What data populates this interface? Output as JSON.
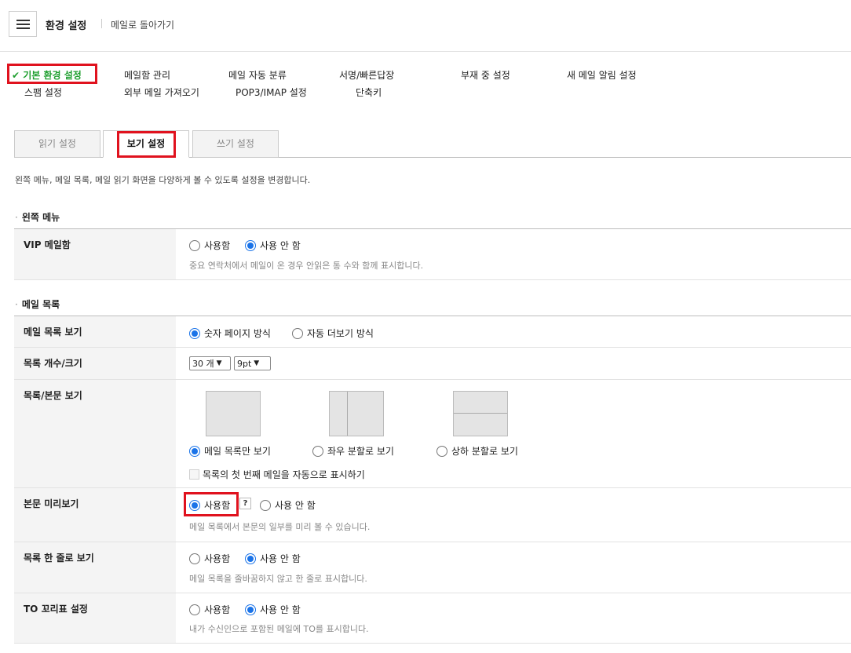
{
  "header": {
    "title": "환경 설정",
    "back_link": "메일로 돌아가기"
  },
  "nav": {
    "row1": [
      "기본 환경 설정",
      "메일함 관리",
      "메일 자동 분류",
      "서명/빠른답장",
      "부재 중 설정",
      "새 메일 알림 설정"
    ],
    "row2": [
      "스팸 설정",
      "외부 메일 가져오기",
      "POP3/IMAP 설정",
      "단축키"
    ],
    "active_check": "✔"
  },
  "tabs": [
    "읽기 설정",
    "보기 설정",
    "쓰기 설정"
  ],
  "description": "왼쪽 메뉴, 메일 목록, 메일 읽기 화면을 다양하게 볼 수 있도록 설정을 변경합니다.",
  "sections": {
    "left_menu": "왼쪽 메뉴",
    "mail_list": "메일 목록"
  },
  "settings": {
    "vip": {
      "label": "VIP 메일함",
      "options": [
        "사용함",
        "사용 안 함"
      ],
      "selected": 1,
      "help": "중요 연락처에서 메일이 온 경우 안읽은 통 수와 함께 표시합니다."
    },
    "list_view": {
      "label": "메일 목록 보기",
      "options": [
        "숫자 페이지 방식",
        "자동 더보기 방식"
      ],
      "selected": 0
    },
    "list_count": {
      "label": "목록 개수/크기",
      "count_value": "30 개",
      "size_value": "9pt"
    },
    "list_body": {
      "label": "목록/본문 보기",
      "options": [
        "메일 목록만 보기",
        "좌우 분할로 보기",
        "상하 분할로 보기"
      ],
      "selected": 0,
      "checkbox": "목록의 첫 번째 메일을 자동으로 표시하기"
    },
    "preview": {
      "label": "본문 미리보기",
      "options": [
        "사용함",
        "사용 안 함"
      ],
      "selected": 0,
      "help_btn": "?",
      "help": "메일 목록에서 본문의 일부를 미리 볼 수 있습니다."
    },
    "one_line": {
      "label": "목록 한 줄로 보기",
      "options": [
        "사용함",
        "사용 안 함"
      ],
      "selected": 1,
      "help": "메일 목록을 줄바꿈하지 않고 한 줄로 표시합니다."
    },
    "to_tag": {
      "label": "TO 꼬리표 설정",
      "options": [
        "사용함",
        "사용 안 함"
      ],
      "selected": 1,
      "help": "내가 수신인으로 포함된 메일에 TO를 표시합니다."
    }
  },
  "colors": {
    "active_nav": "#1e9e2e",
    "highlight_box": "#e0121e",
    "radio_on": "#1a73e8"
  }
}
